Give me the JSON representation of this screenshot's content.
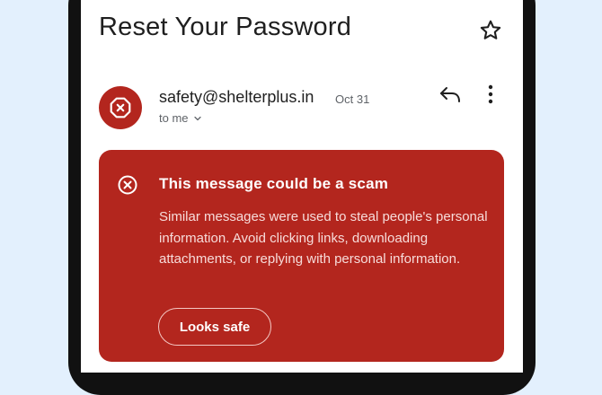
{
  "email": {
    "subject": "Reset Your Password",
    "sender": "safety@shelterplus.in",
    "date": "Oct 31",
    "recipient_label": "to me"
  },
  "warning": {
    "title": "This message could be a scam",
    "body": "Similar messages were used to steal people's personal information. Avoid clicking links, downloading attachments, or replying with personal information.",
    "button_label": "Looks safe"
  },
  "icons": {
    "star": "star-icon",
    "avatar": "warning-avatar-icon",
    "reply": "reply-icon",
    "more": "more-vert-icon",
    "expand": "chevron-down-icon",
    "warning": "x-circle-icon"
  },
  "colors": {
    "background": "#e3f0fd",
    "warning_red": "#b3261e",
    "text": "#1f1f1f",
    "secondary_text": "#5f6368"
  }
}
